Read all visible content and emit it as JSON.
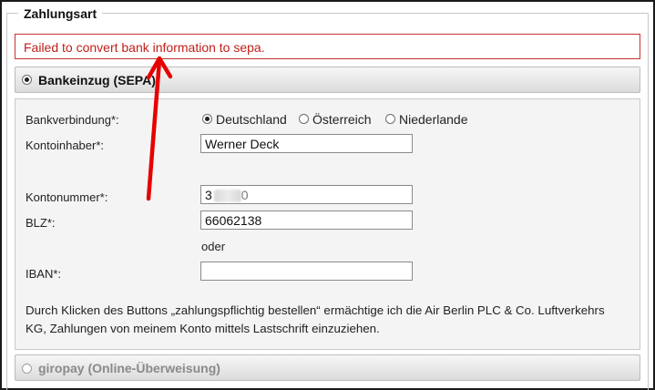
{
  "section": {
    "legend": "Zahlungsart"
  },
  "error": {
    "message": "Failed to convert bank information to sepa."
  },
  "payment_methods": [
    {
      "label": "Bankeinzug (SEPA)",
      "selected": true
    },
    {
      "label": "giropay (Online-Überweisung)",
      "selected": false
    }
  ],
  "form": {
    "bank_label": "Bankverbindung*:",
    "countries": [
      {
        "label": "Deutschland",
        "selected": true
      },
      {
        "label": "Österreich",
        "selected": false
      },
      {
        "label": "Niederlande",
        "selected": false
      }
    ],
    "holder_label": "Kontoinhaber*:",
    "holder_value": "Werner Deck",
    "account_label": "Kontonummer*:",
    "account_value_visible_start": "3",
    "account_value_visible_end": "0",
    "blz_label": "BLZ*:",
    "blz_value": "66062138",
    "or_text": "oder",
    "iban_label": "IBAN*:",
    "iban_value": "",
    "notice": "Durch Klicken des Buttons „zahlungspflichtig bestellen“ ermächtige ich die Air Berlin PLC & Co. Luftverkehrs KG, Zahlungen von meinem Konto mittels Lastschrift einzuziehen."
  },
  "annotation": {
    "color": "#e60000"
  }
}
